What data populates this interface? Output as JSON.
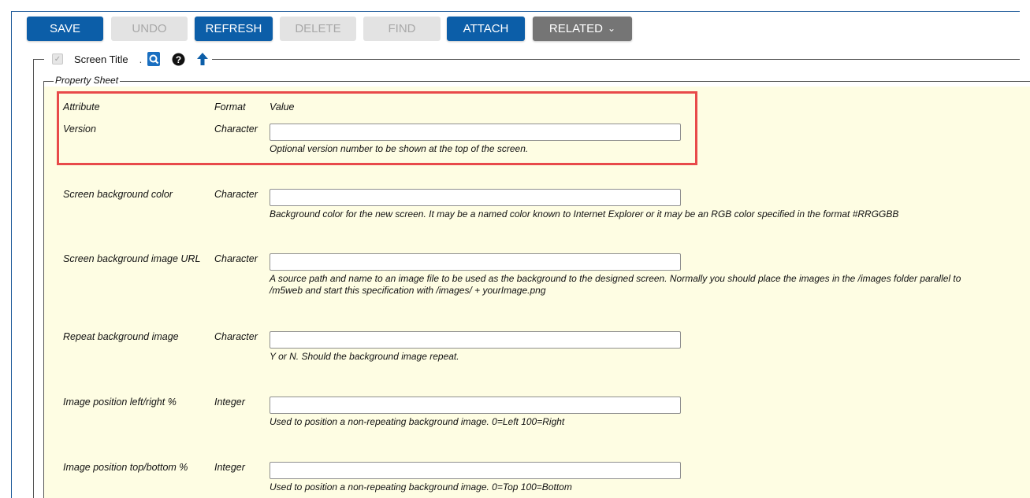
{
  "toolbar": {
    "save": "SAVE",
    "undo": "UNDO",
    "refresh": "REFRESH",
    "delete": "DELETE",
    "find": "FIND",
    "attach": "ATTACH",
    "related": "RELATED"
  },
  "screen_title": {
    "checkbox_checked": true,
    "label": "Screen Title",
    "dot": "."
  },
  "property_sheet": {
    "legend": "Property Sheet",
    "headers": {
      "attribute": "Attribute",
      "format": "Format",
      "value": "Value"
    },
    "rows": [
      {
        "attribute": "Version",
        "format": "Character",
        "value": "",
        "help": "Optional version number to be shown at the top of the screen."
      },
      {
        "attribute": "Screen background color",
        "format": "Character",
        "value": "",
        "help": "Background color for the new screen. It may be a named color known to Internet Explorer or it may be an RGB color specified in the format #RRGGBB"
      },
      {
        "attribute": "Screen background image URL",
        "format": "Character",
        "value": "",
        "help": "A source path and name to an image file to be used as the background to the designed screen. Normally you should place the images in the /images folder parallel to /m5web and start this specification with /images/ + yourImage.png"
      },
      {
        "attribute": "Repeat background image",
        "format": "Character",
        "value": "",
        "help": "Y or N. Should the background image repeat."
      },
      {
        "attribute": "Image position left/right %",
        "format": "Integer",
        "value": "",
        "help": "Used to position a non-repeating background image. 0=Left 100=Right"
      },
      {
        "attribute": "Image position top/bottom %",
        "format": "Integer",
        "value": "",
        "help": "Used to position a non-repeating background image. 0=Top 100=Bottom"
      }
    ]
  },
  "colors": {
    "primary_button": "#0c5ea8",
    "disabled_button": "#e3e3e3",
    "related_button": "#757575",
    "sheet_background": "#fefde3",
    "highlight_border": "#e84a4a"
  }
}
